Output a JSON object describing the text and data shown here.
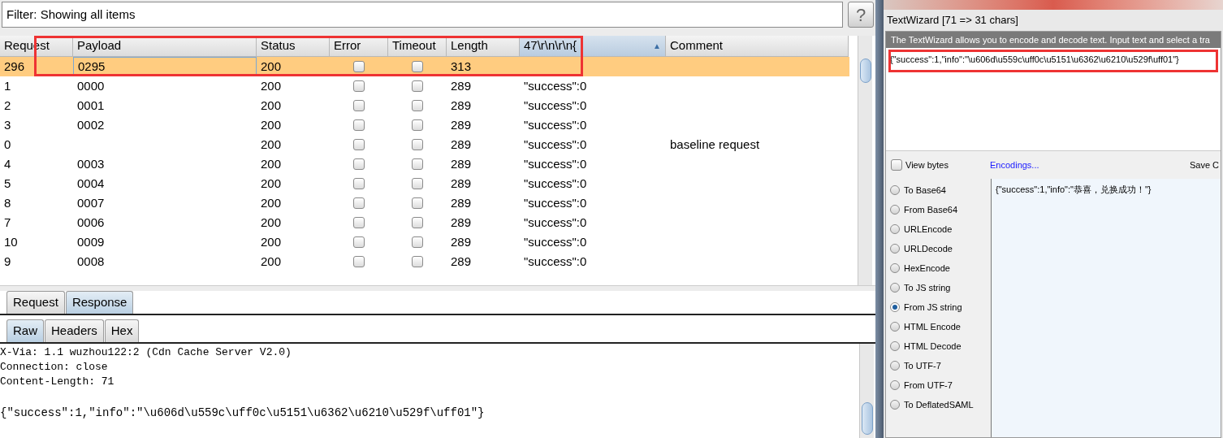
{
  "filter": {
    "text": "Filter: Showing all items",
    "help_button": "?"
  },
  "table": {
    "columns": [
      {
        "label": "Request",
        "sorted": false
      },
      {
        "label": "Payload",
        "sorted": false
      },
      {
        "label": "Status",
        "sorted": false
      },
      {
        "label": "Error",
        "sorted": false
      },
      {
        "label": "Timeout",
        "sorted": false
      },
      {
        "label": "Length",
        "sorted": false
      },
      {
        "label": "47\\r\\n\\r\\n{",
        "sorted": true
      },
      {
        "label": "Comment",
        "sorted": false
      }
    ],
    "sort_arrow": "▲",
    "rows": [
      {
        "request": "296",
        "payload": "0295",
        "status": "200",
        "error": false,
        "timeout": false,
        "length": "313",
        "column_7": "",
        "comment": "",
        "selected": true
      },
      {
        "request": "1",
        "payload": "0000",
        "status": "200",
        "error": false,
        "timeout": false,
        "length": "289",
        "column_7": "\"success\":0",
        "comment": "",
        "selected": false
      },
      {
        "request": "2",
        "payload": "0001",
        "status": "200",
        "error": false,
        "timeout": false,
        "length": "289",
        "column_7": "\"success\":0",
        "comment": "",
        "selected": false
      },
      {
        "request": "3",
        "payload": "0002",
        "status": "200",
        "error": false,
        "timeout": false,
        "length": "289",
        "column_7": "\"success\":0",
        "comment": "",
        "selected": false
      },
      {
        "request": "0",
        "payload": "",
        "status": "200",
        "error": false,
        "timeout": false,
        "length": "289",
        "column_7": "\"success\":0",
        "comment": "baseline request",
        "selected": false
      },
      {
        "request": "4",
        "payload": "0003",
        "status": "200",
        "error": false,
        "timeout": false,
        "length": "289",
        "column_7": "\"success\":0",
        "comment": "",
        "selected": false
      },
      {
        "request": "5",
        "payload": "0004",
        "status": "200",
        "error": false,
        "timeout": false,
        "length": "289",
        "column_7": "\"success\":0",
        "comment": "",
        "selected": false
      },
      {
        "request": "8",
        "payload": "0007",
        "status": "200",
        "error": false,
        "timeout": false,
        "length": "289",
        "column_7": "\"success\":0",
        "comment": "",
        "selected": false
      },
      {
        "request": "7",
        "payload": "0006",
        "status": "200",
        "error": false,
        "timeout": false,
        "length": "289",
        "column_7": "\"success\":0",
        "comment": "",
        "selected": false
      },
      {
        "request": "10",
        "payload": "0009",
        "status": "200",
        "error": false,
        "timeout": false,
        "length": "289",
        "column_7": "\"success\":0",
        "comment": "",
        "selected": false
      },
      {
        "request": "9",
        "payload": "0008",
        "status": "200",
        "error": false,
        "timeout": false,
        "length": "289",
        "column_7": "\"success\":0",
        "comment": "",
        "selected": false
      }
    ]
  },
  "message_tabs": [
    {
      "label": "Request",
      "selected": false
    },
    {
      "label": "Response",
      "selected": true
    }
  ],
  "view_tabs": [
    {
      "label": "Raw",
      "selected": true
    },
    {
      "label": "Headers",
      "selected": false
    },
    {
      "label": "Hex",
      "selected": false
    }
  ],
  "response_headers": [
    "X-Via: 1.1 wuzhou122:2 (Cdn Cache Server V2.0)",
    "Connection: close",
    "Content-Length: 71"
  ],
  "response_body": "{″success″:1,″info″:″\\u606d\\u559c\\uff0c\\u5151\\u6362\\u6210\\u529f\\uff01″}",
  "text_wizard": {
    "title": "TextWizard [71 => 31 chars]",
    "description": "The TextWizard allows you to encode and decode text. Input text and select a tra",
    "input": "{\"success\":1,\"info\":\"\\u606d\\u559c\\uff0c\\u5151\\u6362\\u6210\\u529f\\uff01\"}",
    "view_bytes": {
      "label": "View bytes",
      "checked": false
    },
    "encodings_link": "Encodings...",
    "save_label": "Save C",
    "options": [
      {
        "label": "To Base64",
        "selected": false
      },
      {
        "label": "From Base64",
        "selected": false
      },
      {
        "label": "URLEncode",
        "selected": false
      },
      {
        "label": "URLDecode",
        "selected": false
      },
      {
        "label": "HexEncode",
        "selected": false
      },
      {
        "label": "To JS string",
        "selected": false
      },
      {
        "label": "From JS string",
        "selected": true
      },
      {
        "label": "HTML Encode",
        "selected": false
      },
      {
        "label": "HTML Decode",
        "selected": false
      },
      {
        "label": "To UTF-7",
        "selected": false
      },
      {
        "label": "From UTF-7",
        "selected": false
      },
      {
        "label": "To DeflatedSAML",
        "selected": false
      }
    ],
    "output": "{\"success\":1,\"info\":\"恭喜，兑换成功！\"}"
  }
}
